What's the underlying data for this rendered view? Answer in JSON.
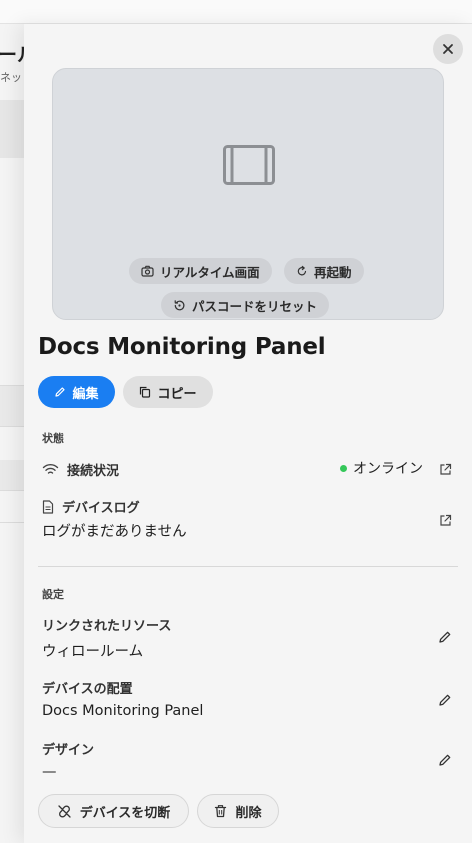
{
  "background": {
    "title": "ール",
    "subtitle": "ネッ"
  },
  "panel": {
    "title": "Docs Monitoring Panel",
    "preview": {
      "realtime_label": "リアルタイム画面",
      "restart_label": "再起動",
      "reset_passcode_label": "パスコードをリセット"
    },
    "actions": {
      "edit_label": "編集",
      "copy_label": "コピー"
    },
    "status_section": {
      "label": "状態",
      "connection_label": "接続状況",
      "connection_value": "オンライン",
      "connection_color": "#34c759",
      "log_label": "デバイスログ",
      "log_value": "ログがまだありません"
    },
    "settings_section": {
      "label": "設定",
      "linked_resource_label": "リンクされたリソース",
      "linked_resource_value": "ウィロールーム",
      "placement_label": "デバイスの配置",
      "placement_value": "Docs Monitoring Panel",
      "design_label": "デザイン",
      "design_value": "—"
    },
    "footer": {
      "disconnect_label": "デバイスを切断",
      "delete_label": "削除"
    },
    "accent_color": "#1a7ef2"
  }
}
